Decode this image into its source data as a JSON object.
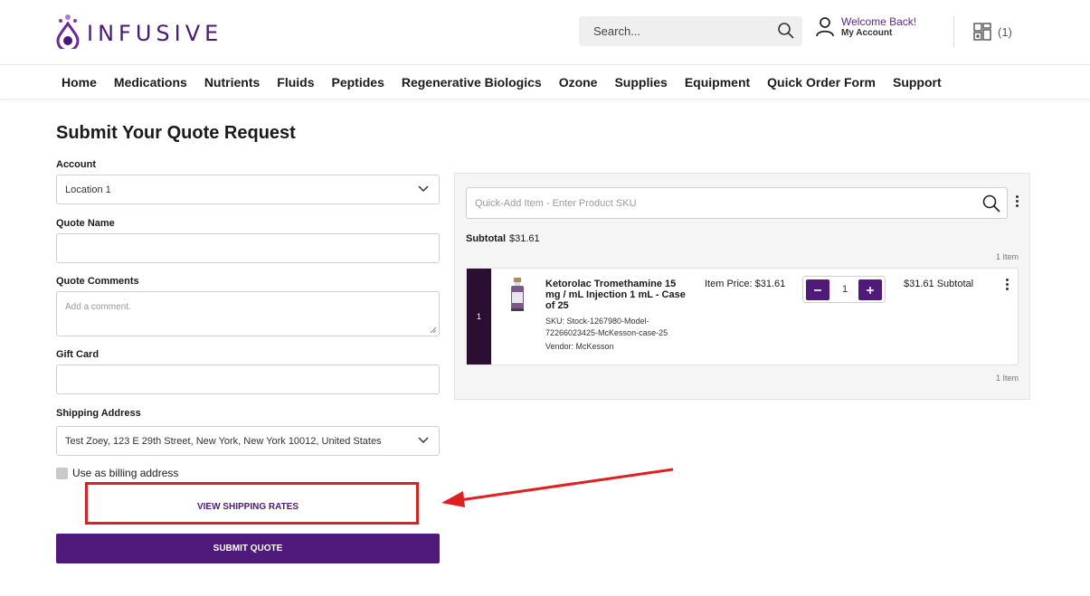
{
  "header": {
    "brand": "INFUSIVE",
    "search_placeholder": "Search...",
    "welcome": "Welcome Back!",
    "my_account": "My Account",
    "cart_count": "(1)",
    "brand_color": "#4a1a78"
  },
  "nav": {
    "items": [
      "Home",
      "Medications",
      "Nutrients",
      "Fluids",
      "Peptides",
      "Regenerative Biologics",
      "Ozone",
      "Supplies",
      "Equipment",
      "Quick Order Form",
      "Support"
    ]
  },
  "form": {
    "title": "Submit Your Quote Request",
    "account_label": "Account",
    "account_value": "Location 1",
    "quote_name_label": "Quote Name",
    "quote_name_value": "",
    "quote_comments_label": "Quote Comments",
    "quote_comments_placeholder": "Add a comment.",
    "gift_card_label": "Gift Card",
    "gift_card_value": "",
    "shipping_address_label": "Shipping Address",
    "shipping_address_value": "Test Zoey, 123 E 29th Street, New York, New York 10012, United States",
    "billing_checkbox_label": "Use as billing address",
    "billing_checked": false,
    "view_shipping_rates": "VIEW SHIPPING RATES",
    "submit_quote": "SUBMIT QUOTE",
    "accent_color": "#4f1a7c",
    "highlight_color": "#e02020"
  },
  "cart": {
    "quick_add_placeholder": "Quick-Add Item - Enter Product SKU",
    "subtotal_label": "Subtotal",
    "subtotal_value": "$31.61",
    "item_count_top": "1 Item",
    "item_count_bottom": "1 Item",
    "items": [
      {
        "index": "1",
        "name": "Ketorolac Tromethamine 15 mg / mL Injection 1 mL - Case of 25",
        "sku": "SKU: Stock-1267980-Model-72266023425-McKesson-case-25",
        "vendor": "Vendor: McKesson",
        "price": "Item Price: $31.61",
        "quantity": "1",
        "subtotal": "$31.61 Subtotal"
      }
    ]
  }
}
